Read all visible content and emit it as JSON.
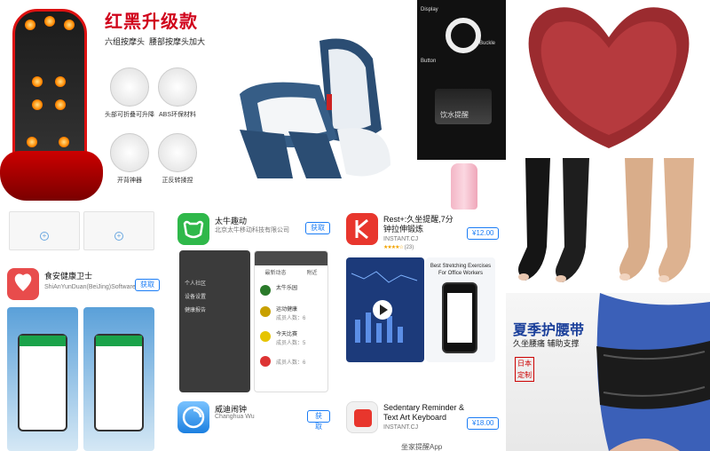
{
  "cushion_ad": {
    "title": "红黑升级款",
    "subtitle_left": "六组按摩头",
    "subtitle_right": "腰部按摩头加大",
    "features": [
      "头部可折叠可升降",
      "ABS环保材料",
      "开背神器",
      "正反转揉捏"
    ]
  },
  "band_ad": {
    "labels": [
      "Display",
      "Buckle",
      "Button"
    ],
    "caption": "饮水提醒"
  },
  "belt_ad": {
    "title": "夏季护腰带",
    "subtitle": "久坐腰痛 辅助支撑",
    "seal": "日本定制"
  },
  "apps": [
    {
      "name": "食安健康卫士",
      "developer": "ShiAnYunDuan(BeiJing)Software...",
      "action": "获取",
      "screens": [
        "screen-1",
        "screen-2"
      ]
    },
    {
      "name": "太牛趣动",
      "developer": "北京太牛移动科技有限公司",
      "action": "获取",
      "screen_left_menu": [
        "个人社区",
        "设备设置",
        "健康报告"
      ],
      "screen_right_tabs": [
        "最新动态",
        "附近"
      ],
      "screen_right_items": [
        "太牛乐园",
        "运动健康",
        "成员人数：6",
        "今天比赛",
        "成员人数：5",
        "成员人数：6"
      ]
    },
    {
      "name": "Rest+:久坐提醒,7分钟拉伸锻炼",
      "developer": "INSTANT.CJ",
      "rating_stars": "★★★★☆",
      "rating_count": "(23)",
      "action": "¥12.00",
      "promo_heading": "Best Stretching Exercises For Office Workers"
    },
    {
      "name": "威迪闹钟",
      "developer": "Changhua Wu",
      "action": "获取"
    },
    {
      "name": "Sedentary Reminder & Text Art Keyboard",
      "developer": "INSTANT.CJ",
      "action": "¥18.00",
      "footer_fragment": "坐家提醒App"
    }
  ],
  "colors": {
    "get_button": "#1a7cf5",
    "rest_icon": "#e8362d",
    "cushion_red": "#d0021b",
    "belt_blue": "#1a3f9a"
  }
}
